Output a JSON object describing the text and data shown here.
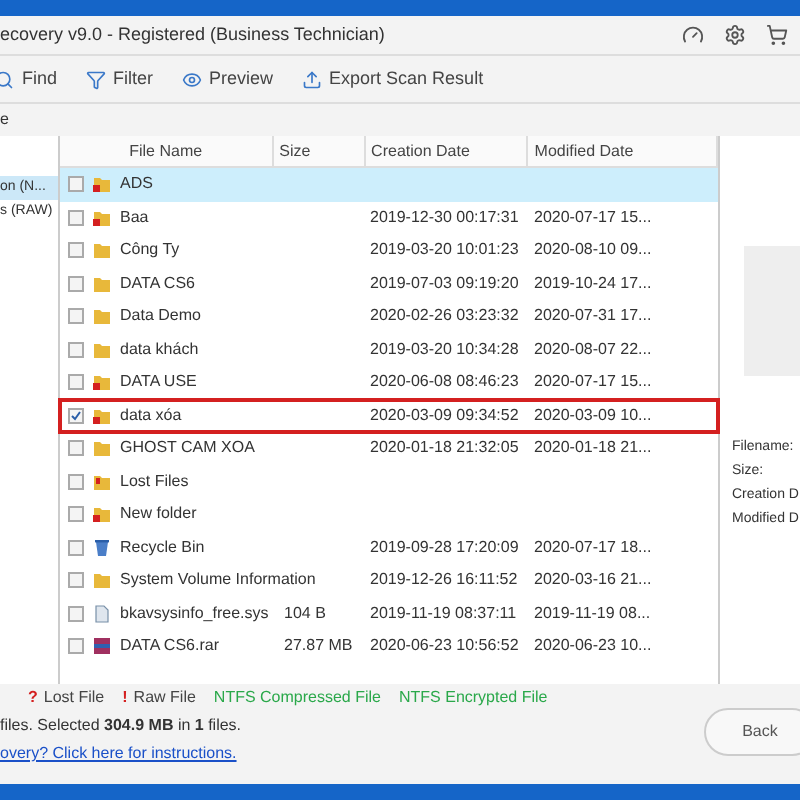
{
  "window": {
    "title": "ecovery v9.0 - Registered (Business Technician)"
  },
  "toolbar": [
    {
      "label": "Find",
      "kind": "search"
    },
    {
      "label": "Filter",
      "kind": "filter"
    },
    {
      "label": "Preview",
      "kind": "eye"
    },
    {
      "label": "Export Scan Result",
      "kind": "export"
    }
  ],
  "path_bar": {
    "text": "e"
  },
  "tree": [
    {
      "label": "on (N...",
      "selected": true
    },
    {
      "label": "s (RAW)",
      "selected": false
    }
  ],
  "table": {
    "columns": [
      "File Name",
      "Size",
      "Creation Date",
      "Modified Date"
    ],
    "rows": [
      {
        "name": "ADS",
        "size": "",
        "created": "",
        "modified": "",
        "kind": "deleted-folder",
        "checked": false,
        "selected": true,
        "highlighted": false
      },
      {
        "name": "Baa",
        "size": "",
        "created": "2019-12-30 00:17:31",
        "modified": "2020-07-17 15...",
        "kind": "deleted-folder",
        "checked": false,
        "selected": false,
        "highlighted": false
      },
      {
        "name": "Công Ty",
        "size": "",
        "created": "2019-03-20 10:01:23",
        "modified": "2020-08-10 09...",
        "kind": "folder",
        "checked": false,
        "selected": false,
        "highlighted": false
      },
      {
        "name": "DATA CS6",
        "size": "",
        "created": "2019-07-03 09:19:20",
        "modified": "2019-10-24 17...",
        "kind": "folder",
        "checked": false,
        "selected": false,
        "highlighted": false
      },
      {
        "name": "Data Demo",
        "size": "",
        "created": "2020-02-26 03:23:32",
        "modified": "2020-07-31 17...",
        "kind": "folder",
        "checked": false,
        "selected": false,
        "highlighted": false
      },
      {
        "name": "data khách",
        "size": "",
        "created": "2019-03-20 10:34:28",
        "modified": "2020-08-07 22...",
        "kind": "folder",
        "checked": false,
        "selected": false,
        "highlighted": false
      },
      {
        "name": "DATA USE",
        "size": "",
        "created": "2020-06-08 08:46:23",
        "modified": "2020-07-17 15...",
        "kind": "deleted-folder",
        "checked": false,
        "selected": false,
        "highlighted": false
      },
      {
        "name": "data xóa",
        "size": "",
        "created": "2020-03-09 09:34:52",
        "modified": "2020-03-09 10...",
        "kind": "deleted-folder",
        "checked": true,
        "selected": false,
        "highlighted": true
      },
      {
        "name": "GHOST CAM XOA",
        "size": "",
        "created": "2020-01-18 21:32:05",
        "modified": "2020-01-18 21...",
        "kind": "folder",
        "checked": false,
        "selected": false,
        "highlighted": false
      },
      {
        "name": "Lost Files",
        "size": "",
        "created": "",
        "modified": "",
        "kind": "lost",
        "checked": false,
        "selected": false,
        "highlighted": false
      },
      {
        "name": "New folder",
        "size": "",
        "created": "",
        "modified": "",
        "kind": "deleted-folder",
        "checked": false,
        "selected": false,
        "highlighted": false
      },
      {
        "name": "Recycle Bin",
        "size": "",
        "created": "2019-09-28 17:20:09",
        "modified": "2020-07-17 18...",
        "kind": "recycle",
        "checked": false,
        "selected": false,
        "highlighted": false
      },
      {
        "name": "System Volume Information",
        "size": "",
        "created": "2019-12-26 16:11:52",
        "modified": "2020-03-16 21...",
        "kind": "folder",
        "checked": false,
        "selected": false,
        "highlighted": false
      },
      {
        "name": "bkavsysinfo_free.sys",
        "size": "104 B",
        "created": "2019-11-19 08:37:11",
        "modified": "2019-11-19 08...",
        "kind": "file",
        "checked": false,
        "selected": false,
        "highlighted": false
      },
      {
        "name": "DATA CS6.rar",
        "size": "27.87 MB",
        "created": "2020-06-23 10:56:52",
        "modified": "2020-06-23 10...",
        "kind": "archive",
        "checked": false,
        "selected": false,
        "highlighted": false
      }
    ]
  },
  "preview": {
    "labels": [
      "Filename:",
      "Size:",
      "Creation D",
      "Modified D"
    ]
  },
  "legend": [
    {
      "mark": "?",
      "label": "Lost File",
      "color": "#d42020"
    },
    {
      "mark": "!",
      "label": "Raw File",
      "color": "#d42020"
    },
    {
      "label": "NTFS Compressed File",
      "color": "#2aa84a"
    },
    {
      "label": "NTFS Encrypted File",
      "color": "#2aa84a"
    }
  ],
  "status": "files.  Selected **304.9 MB** in **1** files.",
  "help_link": "overy? Click here for instructions.",
  "back_button": "Back"
}
